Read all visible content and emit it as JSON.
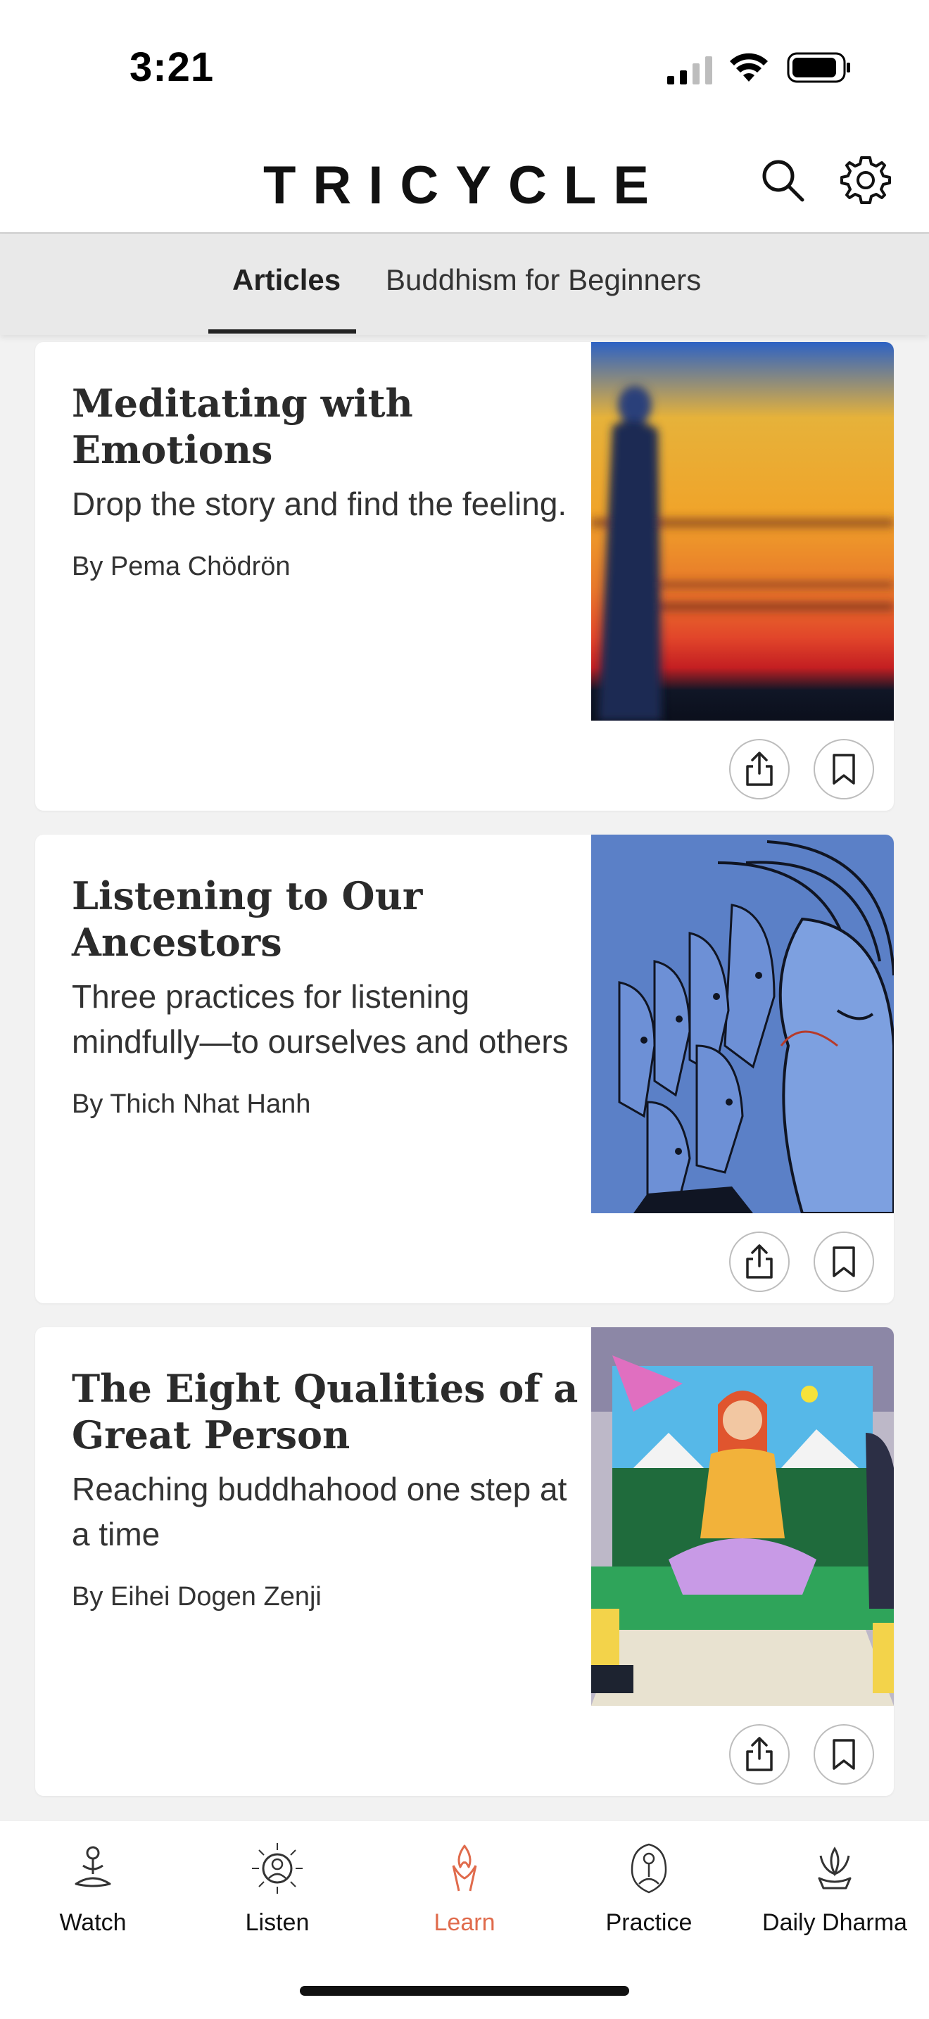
{
  "status": {
    "time": "3:21"
  },
  "header": {
    "logo": "TRICYCLE"
  },
  "tabs": [
    {
      "label": "Articles",
      "active": true
    },
    {
      "label": "Buddhism for Beginners",
      "active": false
    }
  ],
  "articles": [
    {
      "title": "Meditating with Emotions",
      "subtitle": "Drop the story and find the feeling.",
      "author": "By Pema Chödrön"
    },
    {
      "title": "Listening to Our Ancestors",
      "subtitle": "Three practices for listening mindfully—to ourselves and others",
      "author": "By Thich Nhat Hanh"
    },
    {
      "title": "The Eight Qualities of a Great Person",
      "subtitle": "Reaching buddhahood one step at a time",
      "author": "By Eihei Dogen Zenji"
    }
  ],
  "bottom_nav": [
    {
      "label": "Watch",
      "icon": "meditating-figure-icon"
    },
    {
      "label": "Listen",
      "icon": "radiant-buddha-icon"
    },
    {
      "label": "Learn",
      "icon": "flame-hands-icon",
      "active": true
    },
    {
      "label": "Practice",
      "icon": "seated-buddha-icon"
    },
    {
      "label": "Daily Dharma",
      "icon": "lotus-icon"
    }
  ],
  "colors": {
    "accent": "#e06b4c",
    "tabbar_bg": "#e9e9e9",
    "page_bg": "#f2f2f2"
  }
}
